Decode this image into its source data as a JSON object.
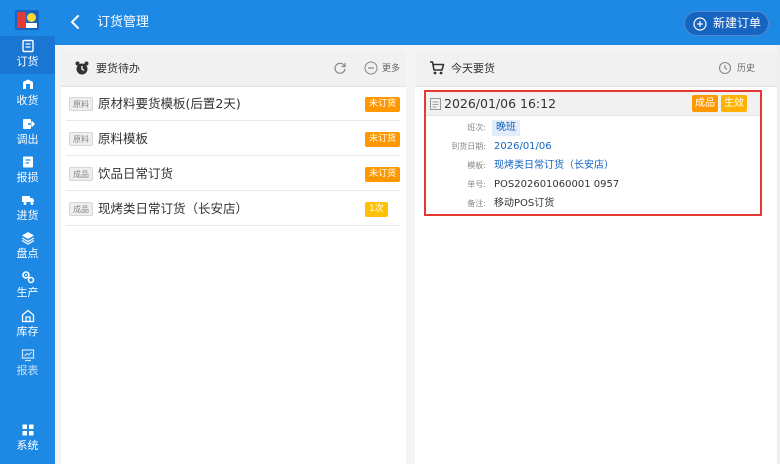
{
  "colors": {
    "primary": "#1e88e5",
    "primary_dark": "#1565c0",
    "orange": "#ff9800",
    "amber": "#ffc107",
    "highlight_border": "#e53935"
  },
  "sidebar": {
    "items": [
      {
        "label": "订货",
        "icon": "order-icon",
        "active": true
      },
      {
        "label": "收货",
        "icon": "receive-icon"
      },
      {
        "label": "调出",
        "icon": "transfer-out-icon"
      },
      {
        "label": "报损",
        "icon": "loss-report-icon"
      },
      {
        "label": "进货",
        "icon": "truck-icon"
      },
      {
        "label": "盘点",
        "icon": "inventory-count-icon"
      },
      {
        "label": "生产",
        "icon": "production-icon"
      },
      {
        "label": "库存",
        "icon": "warehouse-icon"
      },
      {
        "label": "报表",
        "icon": "report-icon",
        "dim": true
      }
    ],
    "system_label": "系统"
  },
  "header": {
    "title": "订货管理",
    "new_button": "新建订单"
  },
  "todo": {
    "title": "要货待办",
    "more": "更多",
    "items": [
      {
        "tag": "原料",
        "name": "原材料要货模板(后置2天)",
        "badge": "未订货"
      },
      {
        "tag": "原料",
        "name": "原料模板",
        "badge": "未订货"
      },
      {
        "tag": "成品",
        "name": "饮品日常订货",
        "badge": "未订货"
      },
      {
        "tag": "成品",
        "name": "现烤类日常订货（长安店）",
        "badge": "1次"
      }
    ]
  },
  "today": {
    "title": "今天要货",
    "history": "历史",
    "order": {
      "datetime": "2026/01/06 16:12",
      "badges": [
        "成品",
        "生效"
      ],
      "fields": [
        {
          "key": "班次:",
          "value": "晚班"
        },
        {
          "key": "到货日期:",
          "value": "2026/01/06"
        },
        {
          "key": "模板:",
          "value": "现烤类日常订货（长安店）"
        },
        {
          "key": "单号:",
          "value": "POS202601060001 0957"
        },
        {
          "key": "备注:",
          "value": "移动POS订货"
        }
      ]
    }
  }
}
